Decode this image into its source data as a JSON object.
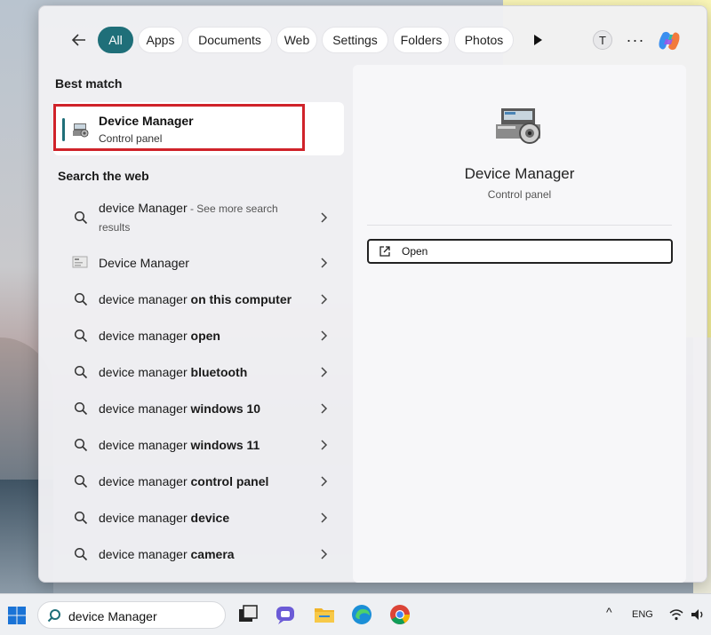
{
  "tabs": [
    {
      "label": "All",
      "active": true
    },
    {
      "label": "Apps"
    },
    {
      "label": "Documents"
    },
    {
      "label": "Web"
    },
    {
      "label": "Settings"
    },
    {
      "label": "Folders"
    },
    {
      "label": "Photos"
    }
  ],
  "account": {
    "initial": "T"
  },
  "more_label": "···",
  "best_match": {
    "heading": "Best match",
    "name": "Device Manager",
    "subtitle": "Control panel"
  },
  "web": {
    "heading": "Search the web",
    "results": [
      {
        "prefix": "device Manager",
        "bold": "",
        "hint": " - See more search results",
        "icon": "search-icon"
      },
      {
        "prefix": "Device Manager",
        "bold": "",
        "hint": "",
        "icon": "device-manager-icon"
      },
      {
        "prefix": "device manager ",
        "bold": "on this computer",
        "hint": "",
        "icon": "search-icon"
      },
      {
        "prefix": "device manager ",
        "bold": "open",
        "hint": "",
        "icon": "search-icon"
      },
      {
        "prefix": "device manager ",
        "bold": "bluetooth",
        "hint": "",
        "icon": "search-icon"
      },
      {
        "prefix": "device manager ",
        "bold": "windows 10",
        "hint": "",
        "icon": "search-icon"
      },
      {
        "prefix": "device manager ",
        "bold": "windows 11",
        "hint": "",
        "icon": "search-icon"
      },
      {
        "prefix": "device manager ",
        "bold": "control panel",
        "hint": "",
        "icon": "search-icon"
      },
      {
        "prefix": "device manager ",
        "bold": "device",
        "hint": "",
        "icon": "search-icon"
      },
      {
        "prefix": "device manager ",
        "bold": "camera",
        "hint": "",
        "icon": "search-icon"
      }
    ]
  },
  "preview": {
    "title": "Device Manager",
    "subtitle": "Control panel",
    "open_label": "Open"
  },
  "taskbar": {
    "search_value": "device Manager",
    "language": "ENG",
    "up_arrow": "^"
  },
  "colors": {
    "accent": "#1f6f79",
    "highlight_box": "#d0232a"
  }
}
